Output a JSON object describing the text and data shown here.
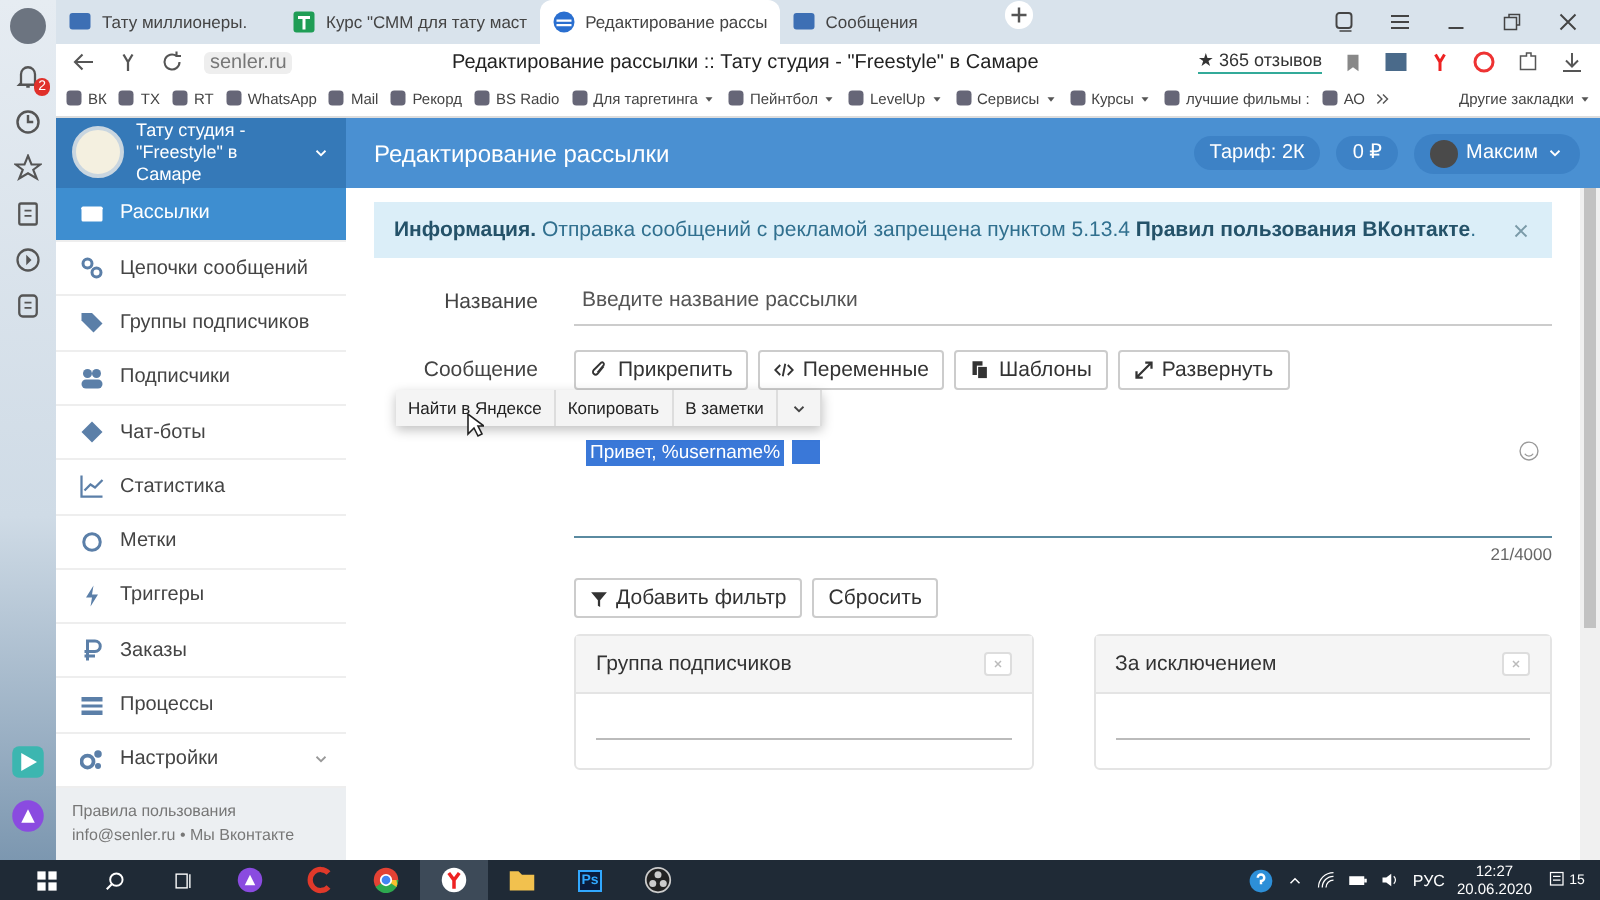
{
  "browser": {
    "tabs": [
      {
        "title": "Тату миллионеры.",
        "selected": false
      },
      {
        "title": "Курс \"СММ для тату маст",
        "selected": false
      },
      {
        "title": "Редактирование рассы",
        "selected": true
      },
      {
        "title": "Сообщения",
        "selected": false
      }
    ],
    "notification_count": "2",
    "address": {
      "url": "senler.ru",
      "page_title": "Редактирование рассылки :: Тату студия - \"Freestyle\" в Самаре",
      "reviews": "★ 365 отзывов"
    },
    "bookmarks": [
      {
        "label": "ВК",
        "kind": "link"
      },
      {
        "label": "ТХ",
        "kind": "link"
      },
      {
        "label": "RT",
        "kind": "link"
      },
      {
        "label": "WhatsApp",
        "kind": "link"
      },
      {
        "label": "Mail",
        "kind": "link"
      },
      {
        "label": "Рекорд",
        "kind": "link"
      },
      {
        "label": "BS Radio",
        "kind": "link"
      },
      {
        "label": "Для таргетинга",
        "kind": "folder"
      },
      {
        "label": "Пейнтбол",
        "kind": "folder"
      },
      {
        "label": "LevelUp",
        "kind": "folder"
      },
      {
        "label": "Сервисы",
        "kind": "folder"
      },
      {
        "label": "Курсы",
        "kind": "folder"
      },
      {
        "label": "лучшие фильмы :",
        "kind": "link"
      },
      {
        "label": "АО",
        "kind": "link"
      }
    ],
    "other_bookmarks": "Другие закладки"
  },
  "app": {
    "brand": "Тату студия - \"Freestyle\" в Самаре",
    "page_title": "Редактирование рассылки",
    "tariff": "Тариф: 2К",
    "balance": "0 ₽",
    "user": "Максим"
  },
  "sidebar": {
    "items": [
      {
        "label": "Рассылки",
        "selected": true,
        "expandable": false
      },
      {
        "label": "Цепочки сообщений",
        "selected": false,
        "expandable": false
      },
      {
        "label": "Группы подписчиков",
        "selected": false,
        "expandable": false
      },
      {
        "label": "Подписчики",
        "selected": false,
        "expandable": false
      },
      {
        "label": "Чат-боты",
        "selected": false,
        "expandable": false
      },
      {
        "label": "Статистика",
        "selected": false,
        "expandable": false
      },
      {
        "label": "Метки",
        "selected": false,
        "expandable": false
      },
      {
        "label": "Триггеры",
        "selected": false,
        "expandable": false
      },
      {
        "label": "Заказы",
        "selected": false,
        "expandable": false
      },
      {
        "label": "Процессы",
        "selected": false,
        "expandable": false
      },
      {
        "label": "Настройки",
        "selected": false,
        "expandable": true
      }
    ],
    "footer": {
      "rules": "Правила пользования",
      "email": "info@senler.ru",
      "separator": "•",
      "vk": "Мы Вконтакте"
    }
  },
  "alert": {
    "text": "**Информация.** Отправка сообщений с рекламой запрещена пунктом 5.13.4 **Правил пользования ВКонтакте**."
  },
  "form": {
    "name_label": "Название",
    "name_placeholder": "Введите название рассылки",
    "message_label": "Сообщение",
    "toolbar": [
      "Прикрепить",
      "Переменные",
      "Шаблоны",
      "Развернуть"
    ],
    "message_value": "Привет, %username%",
    "counter": "21/4000",
    "filter_buttons": [
      "Добавить фильтр",
      "Сбросить"
    ],
    "panels": [
      "Группа подписчиков",
      "За исключением"
    ]
  },
  "context_menu": {
    "items": [
      "Найти в Яндексе",
      "Копировать",
      "В заметки"
    ]
  },
  "taskbar": {
    "apps": [
      {
        "kind": "assistant",
        "selected": false
      },
      {
        "kind": "cleaner",
        "selected": false
      },
      {
        "kind": "chrome",
        "selected": false
      },
      {
        "kind": "yandex",
        "selected": true
      },
      {
        "kind": "folder",
        "selected": false
      },
      {
        "kind": "photoshop",
        "label": "Ps",
        "selected": false
      },
      {
        "kind": "obs",
        "selected": false
      }
    ],
    "language": "РУС",
    "time": "12:27",
    "date": "20.06.2020",
    "notifications": "15"
  }
}
